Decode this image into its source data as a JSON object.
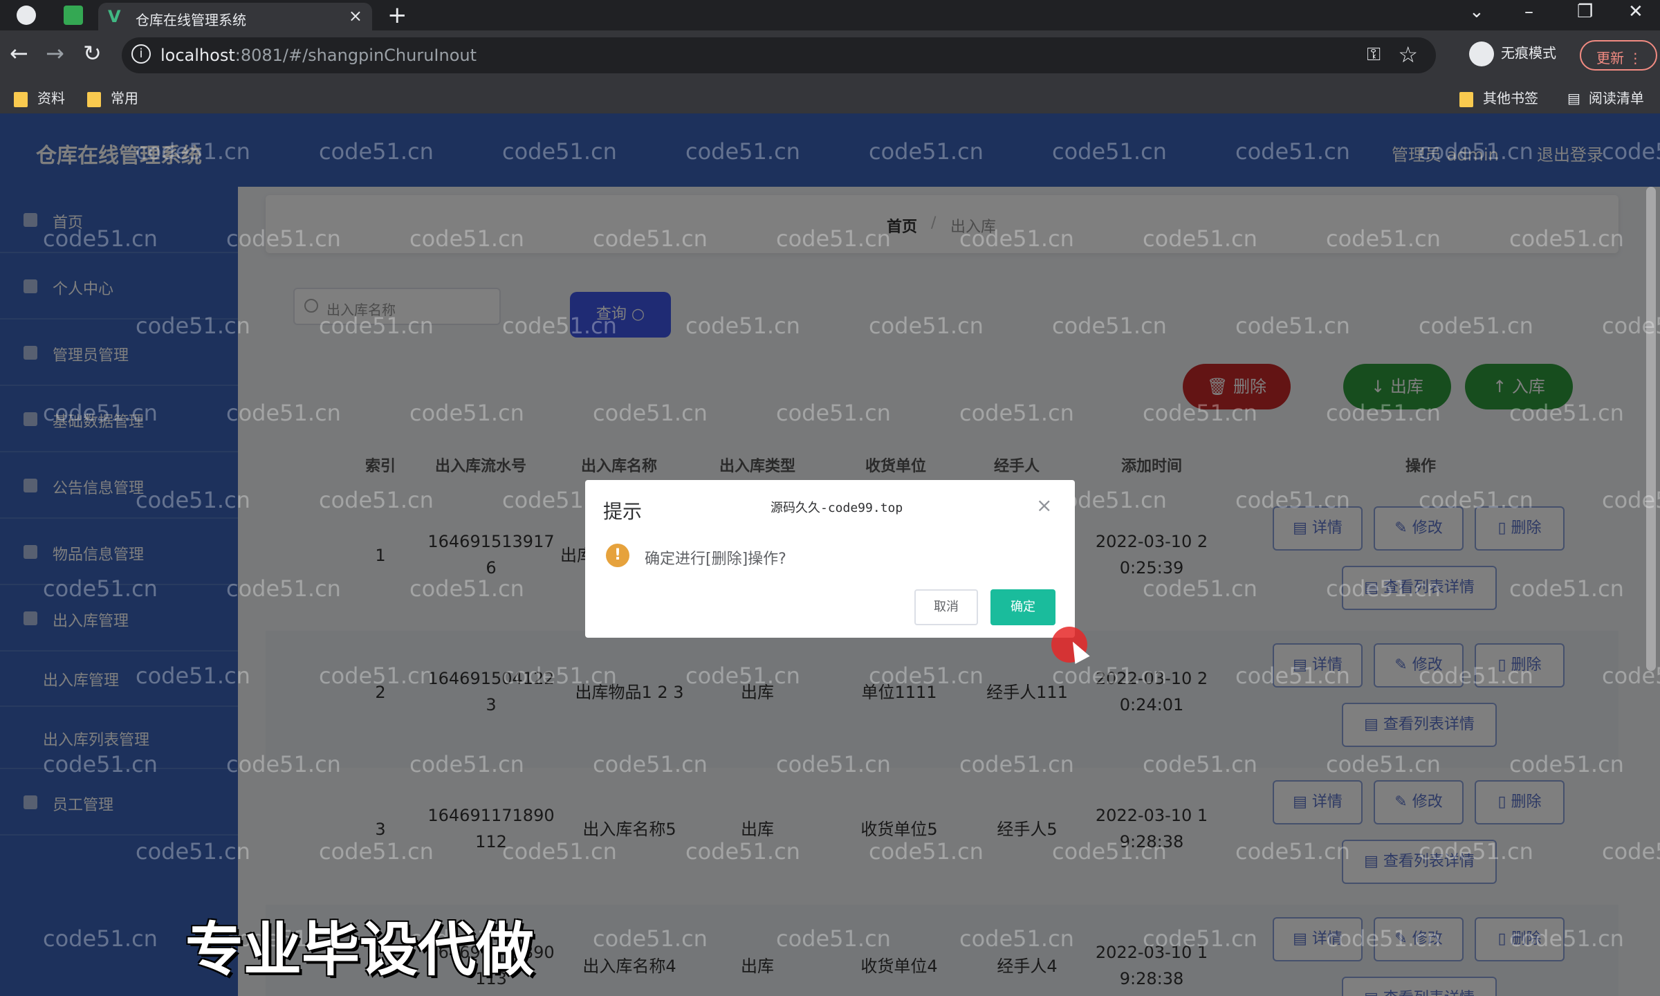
{
  "browser": {
    "tab_title": "仓库在线管理系统",
    "url_host": "localhost",
    "url_rest": ":8081/#/shangpinChuruInout",
    "incognito_label": "无痕模式",
    "update_label": "更新",
    "bookmarks": [
      "资料",
      "常用"
    ],
    "other_bookmarks": "其他书签",
    "reading_list": "阅读清单"
  },
  "app": {
    "title": "仓库在线管理系统",
    "admin_label": "管理员 admin",
    "logout_label": "退出登录"
  },
  "sidebar": {
    "items": [
      {
        "label": "首页"
      },
      {
        "label": "个人中心"
      },
      {
        "label": "管理员管理"
      },
      {
        "label": "基础数据管理"
      },
      {
        "label": "公告信息管理"
      },
      {
        "label": "物品信息管理"
      },
      {
        "label": "出入库管理"
      },
      {
        "label": "出入库管理"
      },
      {
        "label": "出入库列表管理"
      },
      {
        "label": "员工管理"
      }
    ]
  },
  "breadcrumb": {
    "home": "首页",
    "separator": "/",
    "current": "出入库"
  },
  "search": {
    "placeholder": "出入库名称",
    "query_label": "查询"
  },
  "toolbar": {
    "delete_label": "删除",
    "out_label": "出库",
    "in_label": "入库"
  },
  "table": {
    "headers": [
      "索引",
      "出入库流水号",
      "出入库名称",
      "出入库类型",
      "收货单位",
      "经手人",
      "添加时间",
      "操作"
    ],
    "rows": [
      {
        "index": "1",
        "serial": [
          "164691513917",
          "6"
        ],
        "name": "出库",
        "type": "",
        "unit": "",
        "handler": "",
        "time": [
          "2022-03-10 2",
          "0:25:39"
        ]
      },
      {
        "index": "2",
        "serial": [
          "164691504122",
          "3"
        ],
        "name": "出库物品1 2 3",
        "type": "出库",
        "unit": "单位1111",
        "handler": "经手人111",
        "time": [
          "2022-03-10 2",
          "0:24:01"
        ]
      },
      {
        "index": "3",
        "serial": [
          "164691171890",
          "112"
        ],
        "name": "出入库名称5",
        "type": "出库",
        "unit": "收货单位5",
        "handler": "经手人5",
        "time": [
          "2022-03-10 1",
          "9:28:38"
        ]
      },
      {
        "index": "4",
        "serial": [
          "164691171890",
          "113"
        ],
        "name": "出入库名称4",
        "type": "出库",
        "unit": "收货单位4",
        "handler": "经手人4",
        "time": [
          "2022-03-10 1",
          "9:28:38"
        ]
      }
    ],
    "actions": {
      "detail": "详情",
      "edit": "修改",
      "delete": "删除",
      "list_detail": "查看列表详情"
    }
  },
  "dialog": {
    "title": "提示",
    "subtitle": "源码久久-code99.top",
    "message": "确定进行[删除]操作?",
    "cancel_label": "取消",
    "confirm_label": "确定"
  },
  "watermark": "code51.cn",
  "caption": "专业毕设代做",
  "colors": {
    "primary": "#3a63b8",
    "danger": "#c62828",
    "success": "#2e9a3c",
    "confirm": "#1abc9c",
    "warning": "#e6a23c"
  }
}
